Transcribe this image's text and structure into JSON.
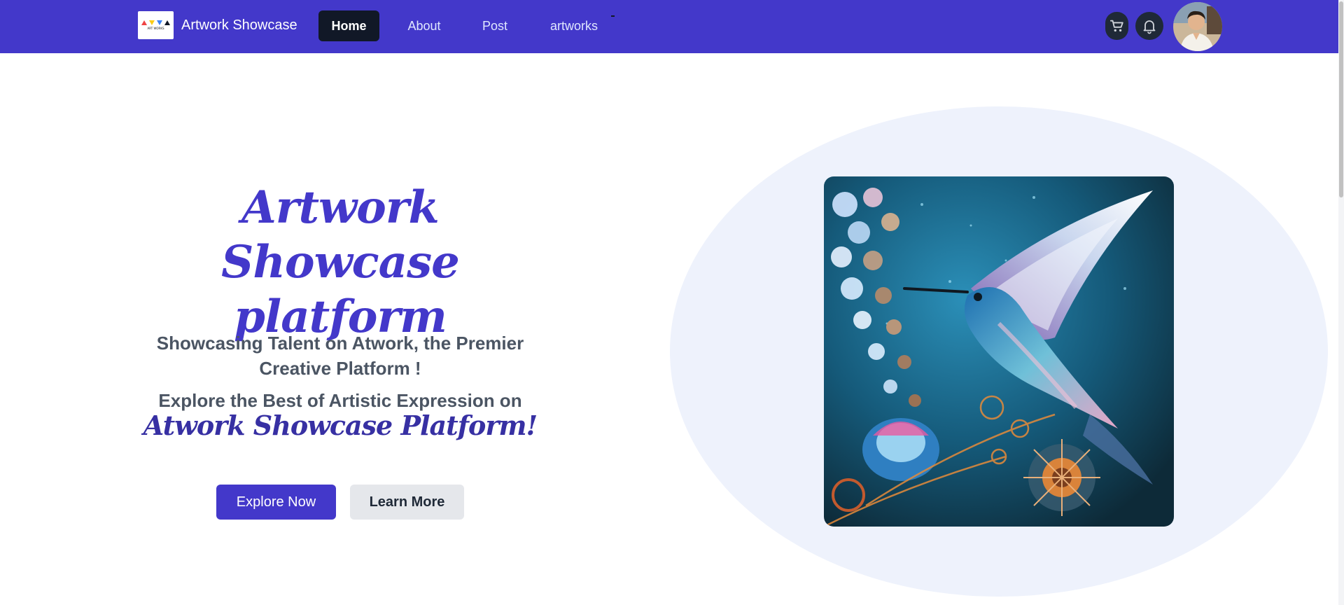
{
  "navbar": {
    "logo_text": "ART WORKS",
    "brand": "Artwork Showcase",
    "links": [
      {
        "label": "Home",
        "active": true
      },
      {
        "label": "About",
        "active": false
      },
      {
        "label": "Post",
        "active": false
      },
      {
        "label": "artworks",
        "active": false
      }
    ],
    "icons": [
      "cart-icon",
      "bell-icon"
    ],
    "avatar": "user-avatar"
  },
  "hero": {
    "title_line1": "Artwork Showcase",
    "title_line2": "platform",
    "subtitle_line1": "Showcasing Talent on Atwork, the Premier",
    "subtitle_line2": "Creative Platform !",
    "explore_text": "Explore the Best of Artistic Expression on",
    "script_text": "Atwork Showcase Platform!",
    "primary_button": "Explore Now",
    "secondary_button": "Learn More",
    "image": "hummingbird-artwork"
  },
  "colors": {
    "accent": "#4338ca",
    "nav_active": "#111827",
    "blob": "#eef2fc",
    "text_muted": "#4b5563"
  }
}
